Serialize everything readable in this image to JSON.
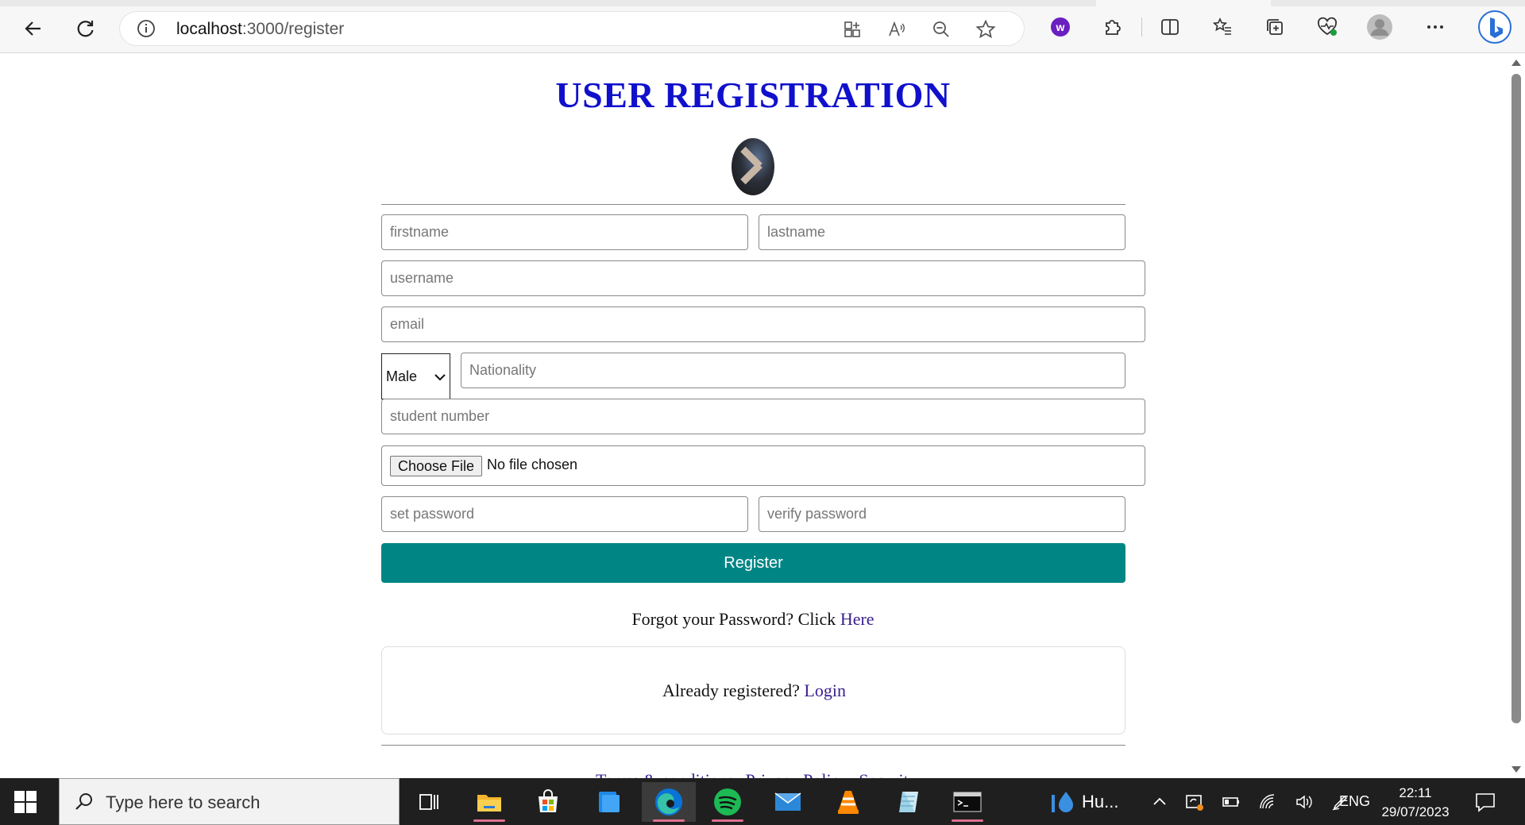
{
  "browser": {
    "url_host": "localhost",
    "url_path": ":3000/register"
  },
  "page": {
    "title": "USER REGISTRATION",
    "form": {
      "firstname_placeholder": "firstname",
      "lastname_placeholder": "lastname",
      "username_placeholder": "username",
      "email_placeholder": "email",
      "gender_selected": "Male",
      "nationality_placeholder": "Nationality",
      "student_number_placeholder": "student number",
      "file_button_label": "Choose File",
      "file_status": "No file chosen",
      "set_password_placeholder": "set password",
      "verify_password_placeholder": "verify password",
      "register_label": "Register"
    },
    "forgot_text": "Forgot your Password? Click",
    "forgot_link": "Here",
    "already_text": "Already registered?",
    "login_link": "Login",
    "footer_links": [
      "Terms & conditions",
      "Privacy Policy",
      "Security"
    ]
  },
  "taskbar": {
    "search_placeholder": "Type here to search",
    "weather_label": "Hu...",
    "language": "ENG",
    "time": "22:11",
    "date": "29/07/2023",
    "accent_color": "#008585"
  }
}
